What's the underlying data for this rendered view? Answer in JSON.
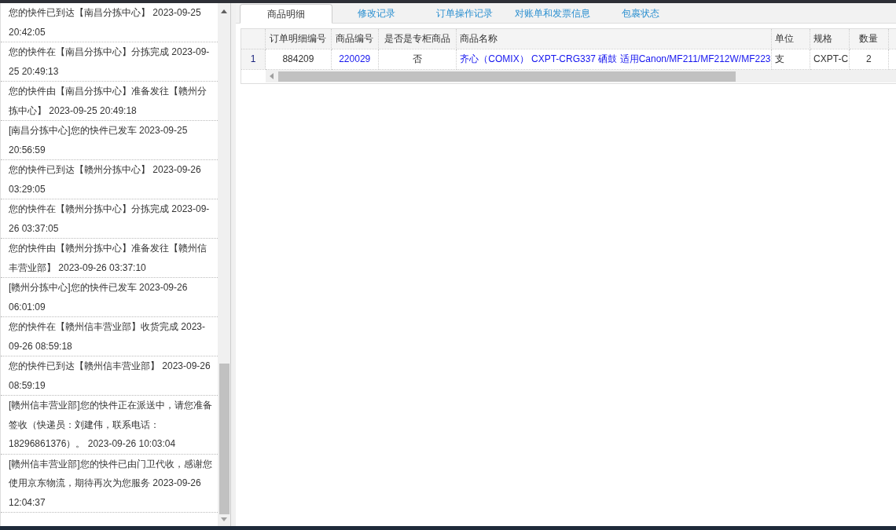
{
  "tracking_events": [
    "您的快件已到达【南昌分拣中心】 2023-09-25 20:42:05",
    "您的快件在【南昌分拣中心】分拣完成 2023-09-25 20:49:13",
    "您的快件由【南昌分拣中心】准备发往【赣州分拣中心】 2023-09-25 20:49:18",
    "[南昌分拣中心]您的快件已发车 2023-09-25 20:56:59",
    "您的快件已到达【赣州分拣中心】 2023-09-26 03:29:05",
    "您的快件在【赣州分拣中心】分拣完成 2023-09-26 03:37:05",
    "您的快件由【赣州分拣中心】准备发往【赣州信丰营业部】 2023-09-26 03:37:10",
    "[赣州分拣中心]您的快件已发车 2023-09-26 06:01:09",
    "您的快件在【赣州信丰营业部】收货完成 2023-09-26 08:59:18",
    "您的快件已到达【赣州信丰营业部】 2023-09-26 08:59:19",
    "[赣州信丰营业部]您的快件正在派送中，请您准备签收（快递员：刘建伟，联系电话：18296861376）。 2023-09-26 10:03:04",
    "[赣州信丰营业部]您的快件已由门卫代收，感谢您使用京东物流，期待再次为您服务 2023-09-26 12:04:37"
  ],
  "tabs": [
    {
      "label": "商品明细",
      "selected": true
    },
    {
      "label": "修改记录",
      "selected": false
    },
    {
      "label": "订单操作记录",
      "selected": false
    },
    {
      "label": "对账单和发票信息",
      "selected": false
    },
    {
      "label": "包裹状态",
      "selected": false
    }
  ],
  "table": {
    "columns": [
      {
        "label": "订单明细编号",
        "link": false
      },
      {
        "label": "商品编号",
        "link": true
      },
      {
        "label": "是否是专柜商品",
        "link": false
      },
      {
        "label": "商品名称",
        "link": true
      },
      {
        "label": "单位",
        "link": false
      },
      {
        "label": "规格",
        "link": false
      },
      {
        "label": "数量",
        "link": false
      }
    ],
    "rows": [
      {
        "number": "1",
        "cells": [
          "884209",
          "220029",
          "否",
          "齐心（COMIX） CXPT-CRG337 硒鼓 适用Canon/MF211/MF212W/MF223",
          "支",
          "CXPT-C",
          "2"
        ]
      }
    ]
  }
}
